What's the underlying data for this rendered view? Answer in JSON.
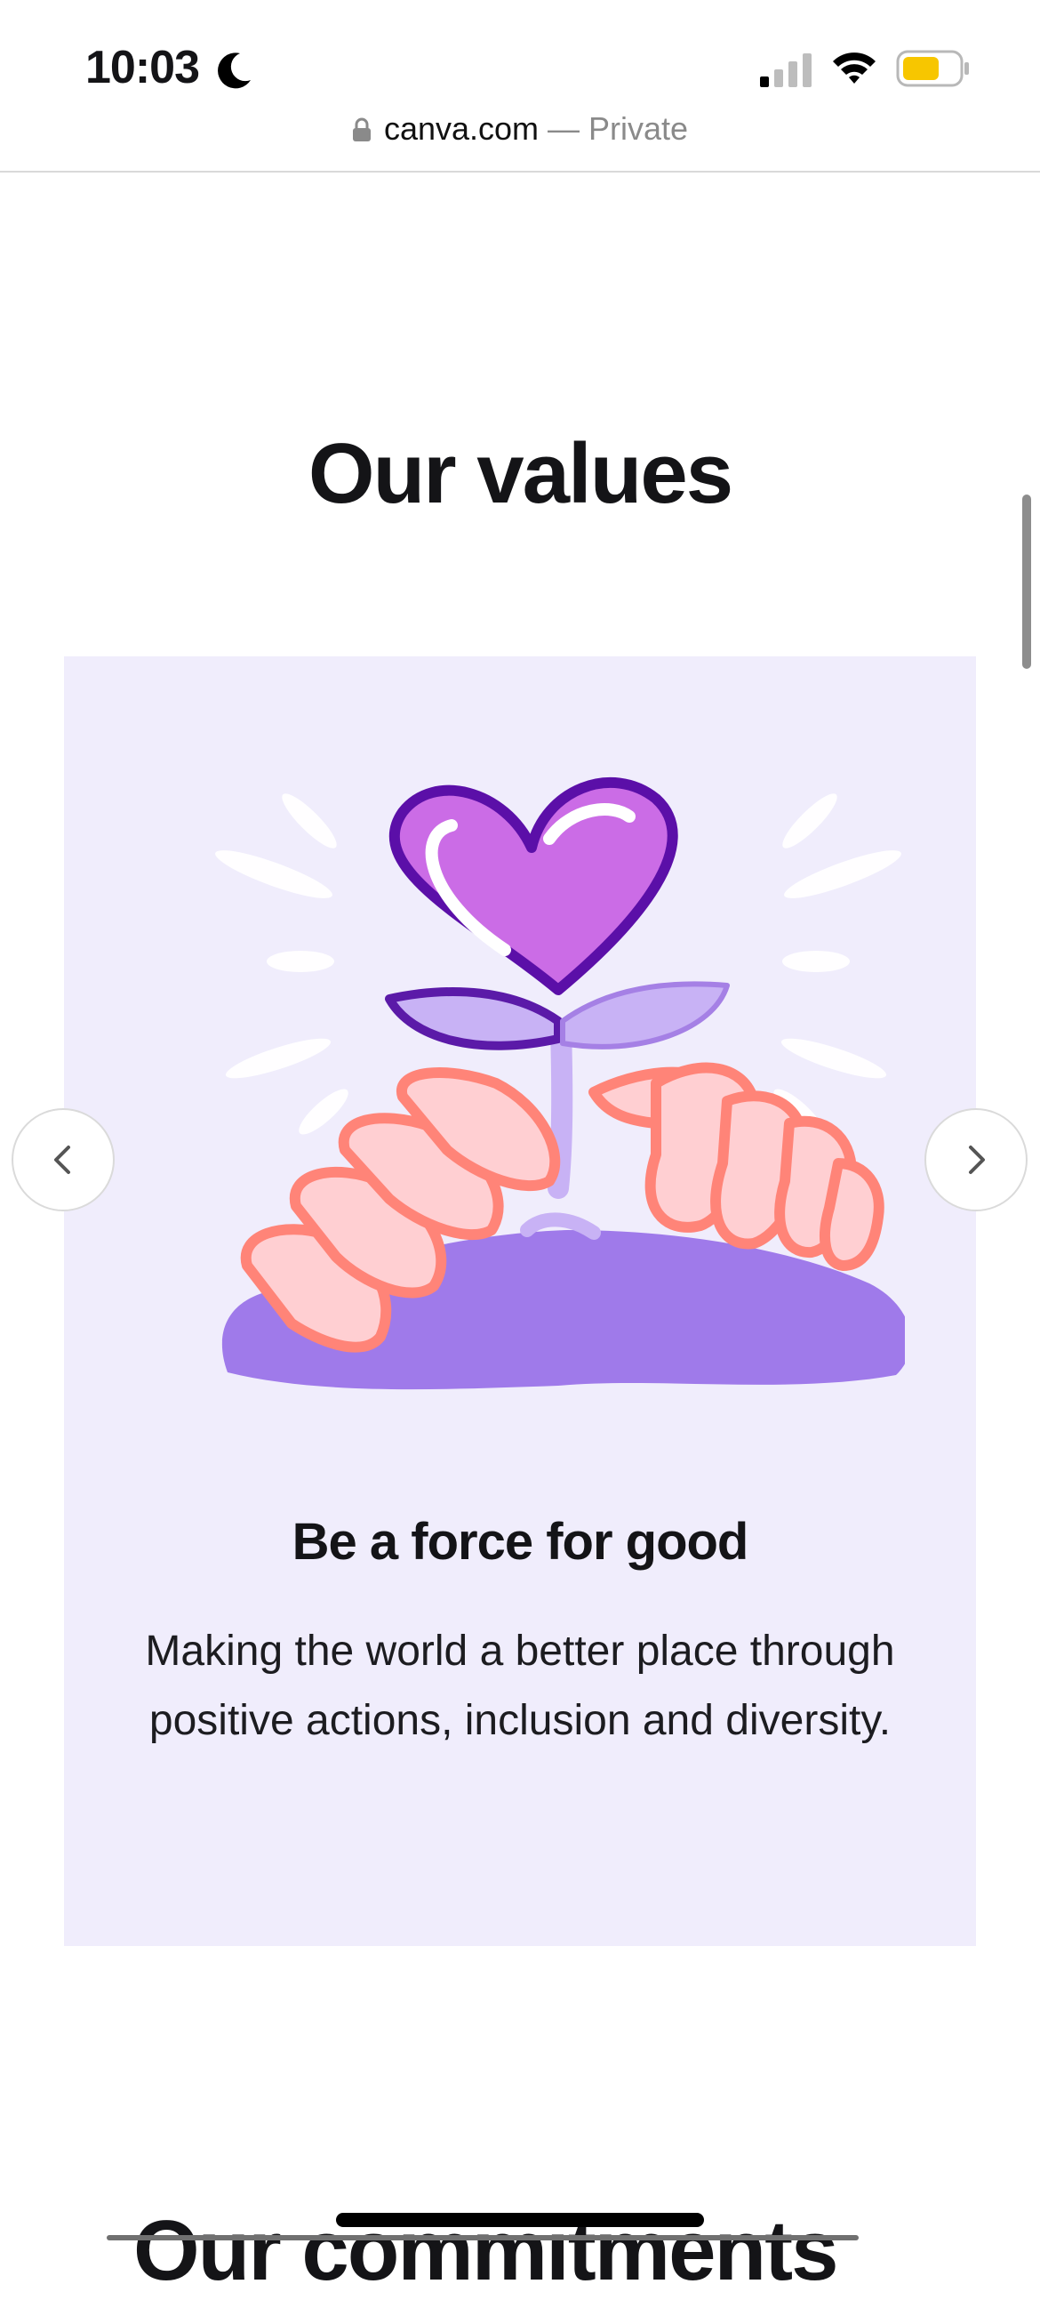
{
  "status_bar": {
    "time": "10:03",
    "battery_color": "#f7c600"
  },
  "url_bar": {
    "domain": "canva.com",
    "suffix": " — Private"
  },
  "section": {
    "title": "Our values"
  },
  "card": {
    "background": "#f0edfc",
    "title": "Be a force for good",
    "text": "Making the world a better place through positive actions, inclusion and diversity."
  },
  "carousel": {
    "prev_icon": "chevron-left-icon",
    "next_icon": "chevron-right-icon"
  },
  "next_section": {
    "title": "Our commitments"
  }
}
